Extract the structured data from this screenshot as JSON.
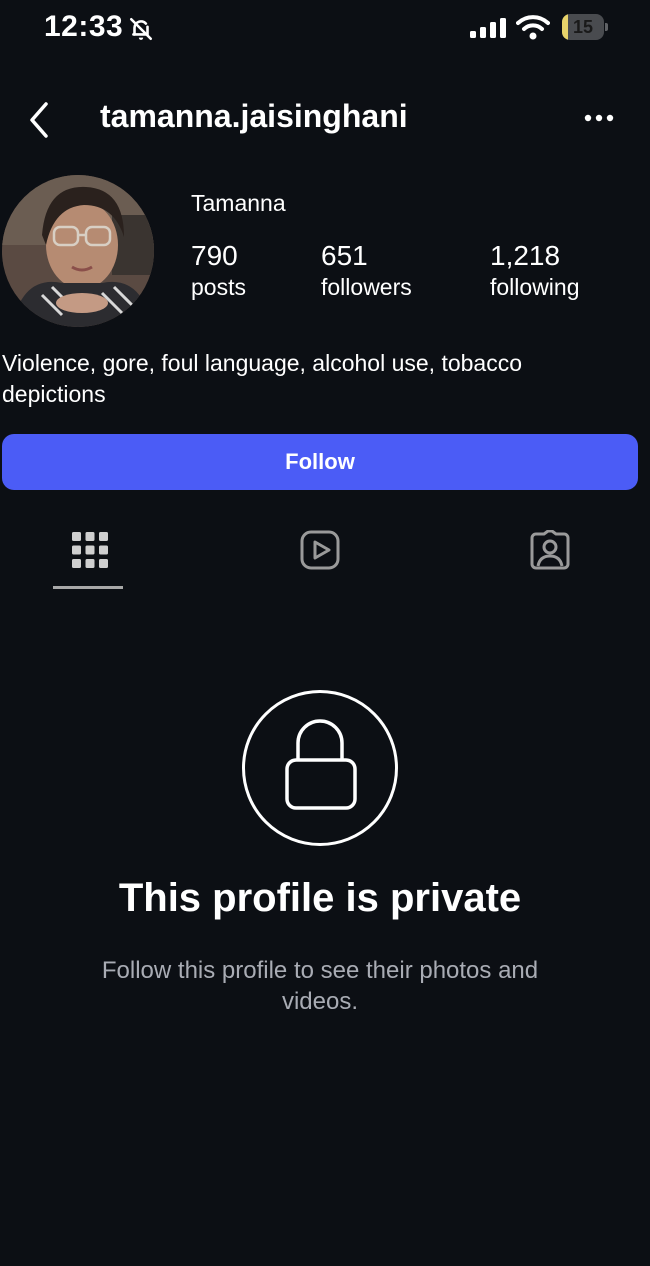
{
  "status_bar": {
    "time": "12:33",
    "bell_icon": "bell-slash-icon",
    "signal_icon": "cellular-signal-icon",
    "wifi_icon": "wifi-icon",
    "battery_level": "15",
    "battery_fraction": 0.15,
    "battery_color": "#e8d36a"
  },
  "header": {
    "back_icon": "chevron-left-icon",
    "username": "tamanna.jaisinghani",
    "more_icon": "more-horizontal-icon"
  },
  "profile": {
    "display_name": "Tamanna",
    "stats": {
      "posts": {
        "value": "790",
        "label": "posts"
      },
      "followers": {
        "value": "651",
        "label": "followers"
      },
      "following": {
        "value": "1,218",
        "label": "following"
      }
    },
    "bio": "Violence, gore, foul language, alcohol use, tobacco depictions",
    "follow_button": "Follow",
    "accent_color": "#4b5cf6"
  },
  "tabs": [
    {
      "icon": "grid-icon",
      "active": true
    },
    {
      "icon": "reels-icon",
      "active": false
    },
    {
      "icon": "tagged-icon",
      "active": false
    }
  ],
  "private_notice": {
    "icon": "lock-icon",
    "title": "This profile is private",
    "subtitle": "Follow this profile to see their photos and videos."
  }
}
